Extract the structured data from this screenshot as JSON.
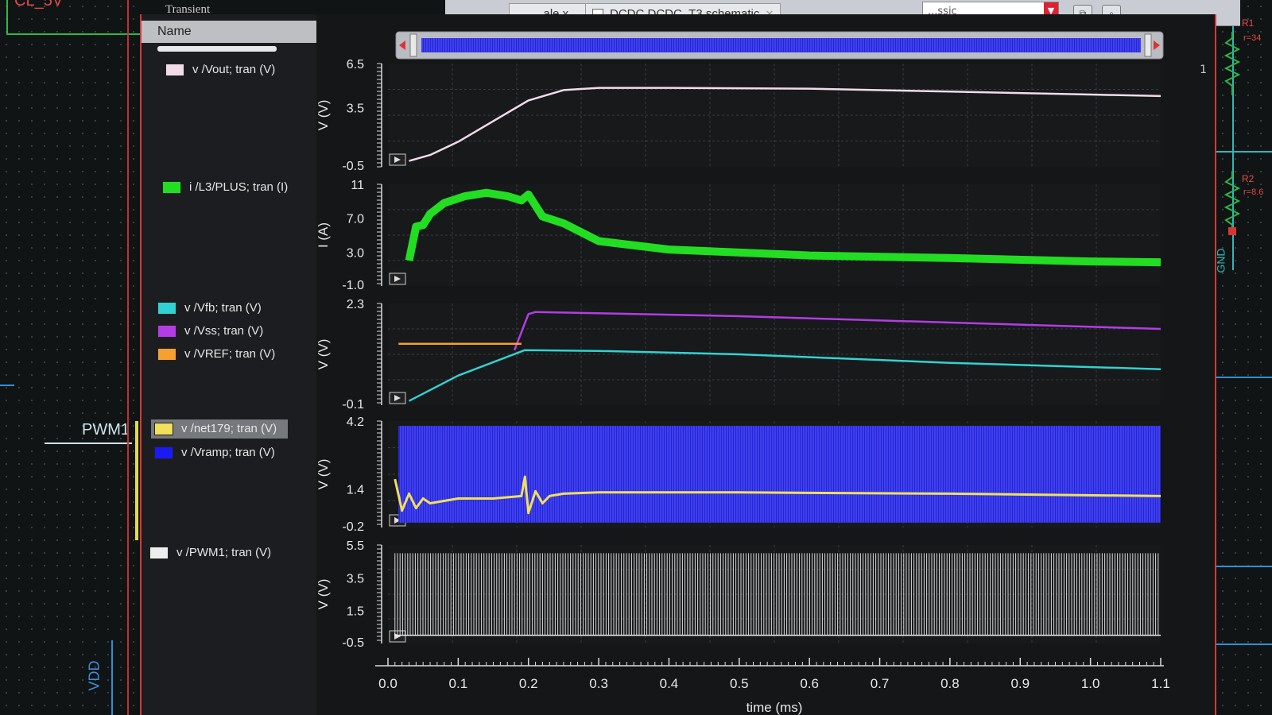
{
  "schematic": {
    "left_labels": {
      "top_net": "CL_5V",
      "pwm": "PWM1",
      "vdd": "VDD"
    },
    "right_labels": {
      "r1": "R1",
      "r1_value": "r=34",
      "r2": "R2",
      "r2_value": "r=8.6",
      "gnd": "GND"
    }
  },
  "window": {
    "tabs": [
      {
        "label": "...ale x"
      },
      {
        "label": "DCDC DCDC_T3 schematic"
      }
    ],
    "combo_value": "...ssic",
    "page_number": "1"
  },
  "legend": {
    "title": "Transient",
    "header": "Name",
    "groups": [
      {
        "items": [
          {
            "label": "v /Vout; tran (V)",
            "color": "#f2dbe9"
          }
        ]
      },
      {
        "items": [
          {
            "label": "i /L3/PLUS; tran (I)",
            "color": "#22dd22"
          }
        ]
      },
      {
        "items": [
          {
            "label": "v /Vfb; tran (V)",
            "color": "#32d2d2"
          },
          {
            "label": "v /Vss; tran (V)",
            "color": "#b43ce6"
          },
          {
            "label": "v /VREF; tran (V)",
            "color": "#f5a032"
          }
        ]
      },
      {
        "items": [
          {
            "label": "v /net179; tran (V)",
            "color": "#f0e05a",
            "selected": true
          },
          {
            "label": "v /Vramp; tran (V)",
            "color": "#1a1af5"
          }
        ]
      },
      {
        "items": [
          {
            "label": "v /PWM1; tran (V)",
            "color": "#eeeeee"
          }
        ]
      }
    ]
  },
  "chart_data": [
    {
      "type": "line",
      "ylabel": "V (V)",
      "yticks": [
        "6.5",
        "3.5",
        "-0.5"
      ],
      "ylim": [
        -0.5,
        6.5
      ],
      "series": [
        {
          "name": "v /Vout; tran (V)",
          "color": "#f2dbe9",
          "x": [
            0.03,
            0.06,
            0.1,
            0.15,
            0.2,
            0.25,
            0.3,
            0.4,
            0.6,
            0.8,
            1.0,
            1.1
          ],
          "y": [
            -0.1,
            0.3,
            1.2,
            2.6,
            4.0,
            4.7,
            4.85,
            4.85,
            4.8,
            4.6,
            4.4,
            4.3
          ]
        }
      ]
    },
    {
      "type": "line",
      "ylabel": "I (A)",
      "yticks": [
        "11",
        "7.0",
        "3.0",
        "-1.0"
      ],
      "ylim": [
        -1.0,
        11.0
      ],
      "series": [
        {
          "name": "i /L3/PLUS; tran (I)",
          "color": "#22dd22",
          "x": [
            0.03,
            0.04,
            0.05,
            0.06,
            0.08,
            0.11,
            0.14,
            0.17,
            0.19,
            0.2,
            0.22,
            0.25,
            0.3,
            0.4,
            0.6,
            0.8,
            1.0,
            1.1
          ],
          "y": [
            2.0,
            6.0,
            6.2,
            7.5,
            8.8,
            9.6,
            10.0,
            9.6,
            9.1,
            9.8,
            7.2,
            6.4,
            4.3,
            3.3,
            2.6,
            2.3,
            1.9,
            1.8
          ]
        }
      ]
    },
    {
      "type": "line",
      "ylabel": "V (V)",
      "yticks": [
        "2.3",
        "-0.1"
      ],
      "ylim": [
        -0.1,
        2.3
      ],
      "series": [
        {
          "name": "v /Vfb; tran (V)",
          "color": "#32d2d2",
          "x": [
            0.03,
            0.1,
            0.195,
            0.3,
            0.5,
            0.8,
            1.1
          ],
          "y": [
            0.0,
            0.6,
            1.2,
            1.18,
            1.1,
            0.9,
            0.75
          ]
        },
        {
          "name": "v /Vss; tran (V)",
          "color": "#b43ce6",
          "x": [
            0.18,
            0.2,
            0.21,
            0.5,
            0.8,
            1.1
          ],
          "y": [
            1.2,
            2.05,
            2.1,
            2.0,
            1.85,
            1.7
          ]
        },
        {
          "name": "v /VREF; tran (V)",
          "color": "#f5a032",
          "x": [
            0.015,
            0.19
          ],
          "y": [
            1.35,
            1.35
          ]
        }
      ]
    },
    {
      "type": "line",
      "ylabel": "V (V)",
      "yticks": [
        "4.2",
        "1.4",
        "-0.2"
      ],
      "ylim": [
        -0.2,
        4.2
      ],
      "series": [
        {
          "name": "v /Vramp; tran (V)",
          "color": "#1a1af5",
          "envelope": [
            0.0,
            4.0
          ]
        },
        {
          "name": "v /net179; tran (V)",
          "color": "#f0e05a",
          "x": [
            0.01,
            0.02,
            0.03,
            0.04,
            0.05,
            0.06,
            0.1,
            0.15,
            0.19,
            0.195,
            0.2,
            0.21,
            0.22,
            0.23,
            0.25,
            0.3,
            0.5,
            0.8,
            1.1
          ],
          "y": [
            1.8,
            0.5,
            1.2,
            0.6,
            1.0,
            0.8,
            1.0,
            1.0,
            1.1,
            1.9,
            0.4,
            1.3,
            0.8,
            1.1,
            1.2,
            1.25,
            1.25,
            1.2,
            1.1
          ]
        }
      ]
    },
    {
      "type": "line",
      "ylabel": "V (V)",
      "yticks": [
        "5.5",
        "3.5",
        "1.5",
        "-0.5"
      ],
      "ylim": [
        -0.5,
        5.5
      ],
      "series": [
        {
          "name": "v /PWM1; tran (V)",
          "color": "#eeeeee",
          "pulse": [
            0.0,
            5.0
          ],
          "x_range": [
            0.01,
            1.1
          ]
        }
      ]
    }
  ],
  "x_axis": {
    "label": "time (ms)",
    "ticks": [
      "0.0",
      "0.1",
      "0.2",
      "0.3",
      "0.4",
      "0.5",
      "0.6",
      "0.7",
      "0.8",
      "0.9",
      "1.0",
      "1.1"
    ],
    "xlim": [
      0.0,
      1.1
    ]
  }
}
